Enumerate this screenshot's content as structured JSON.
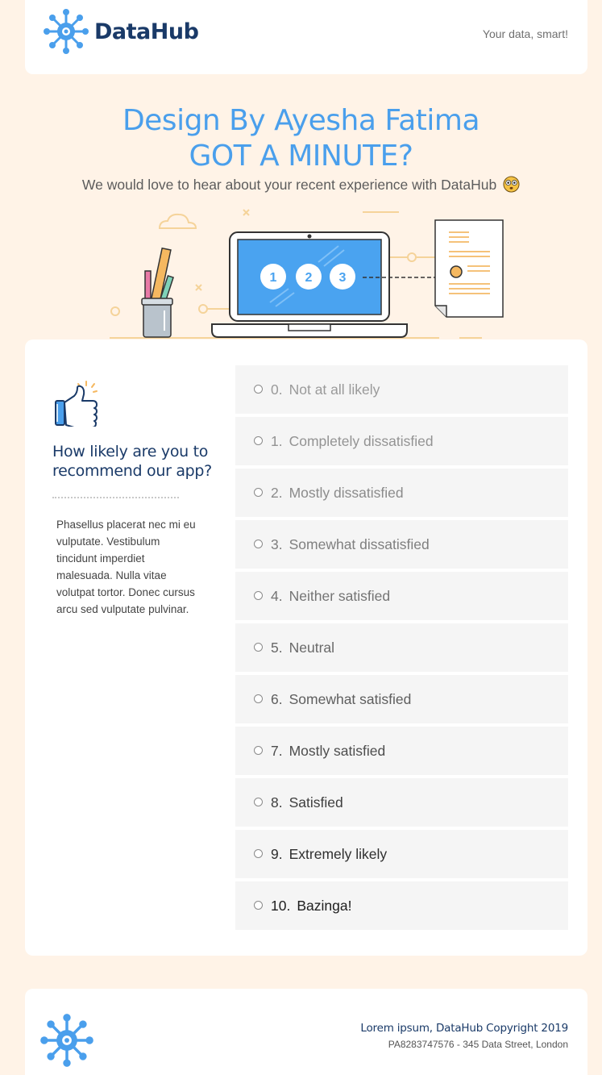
{
  "header": {
    "brand": "DataHub",
    "tagline": "Your data, smart!"
  },
  "hero": {
    "title": "Design By Ayesha Fatima",
    "subtitle": "GOT A MINUTE?",
    "description": "We would love to hear about your recent experience with DataHub"
  },
  "illustration": {
    "steps": [
      "1",
      "2",
      "3"
    ]
  },
  "survey": {
    "question": "How likely are you to recommend our app?",
    "body": "Phasellus placerat nec mi eu vulputate. Vestibulum tincidunt imperdiet malesuada. Nulla vitae volutpat tortor. Donec cursus arcu sed vulputate pulvinar.",
    "options": [
      {
        "num": "0.",
        "label": "Not at all likely",
        "color": "#9a9a9a"
      },
      {
        "num": "1.",
        "label": "Completely dissatisfied",
        "color": "#939393"
      },
      {
        "num": "2.",
        "label": "Mostly dissatisfied",
        "color": "#8b8b8b"
      },
      {
        "num": "3.",
        "label": "Somewhat dissatisfied",
        "color": "#7f7f7f"
      },
      {
        "num": "4.",
        "label": "Neither satisfied",
        "color": "#747474"
      },
      {
        "num": "5.",
        "label": "Neutral",
        "color": "#696969"
      },
      {
        "num": "6.",
        "label": "Somewhat satisfied",
        "color": "#5e5e5e"
      },
      {
        "num": "7.",
        "label": "Mostly satisfied",
        "color": "#4d4d4d"
      },
      {
        "num": "8.",
        "label": "Satisfied",
        "color": "#3e3e3e"
      },
      {
        "num": "9.",
        "label": "Extremely likely",
        "color": "#2f2f2f"
      },
      {
        "num": "10.",
        "label": "Bazinga!",
        "color": "#1e1e1e"
      }
    ]
  },
  "footer": {
    "copyright": "Lorem ipsum, DataHub Copyright 2019",
    "address": "PA8283747576 - 345 Data Street, London"
  },
  "colors": {
    "background": "#fff3e7",
    "brand_blue": "#4a9fec",
    "navy": "#1a3a68",
    "accent_orange": "#f5b860"
  }
}
